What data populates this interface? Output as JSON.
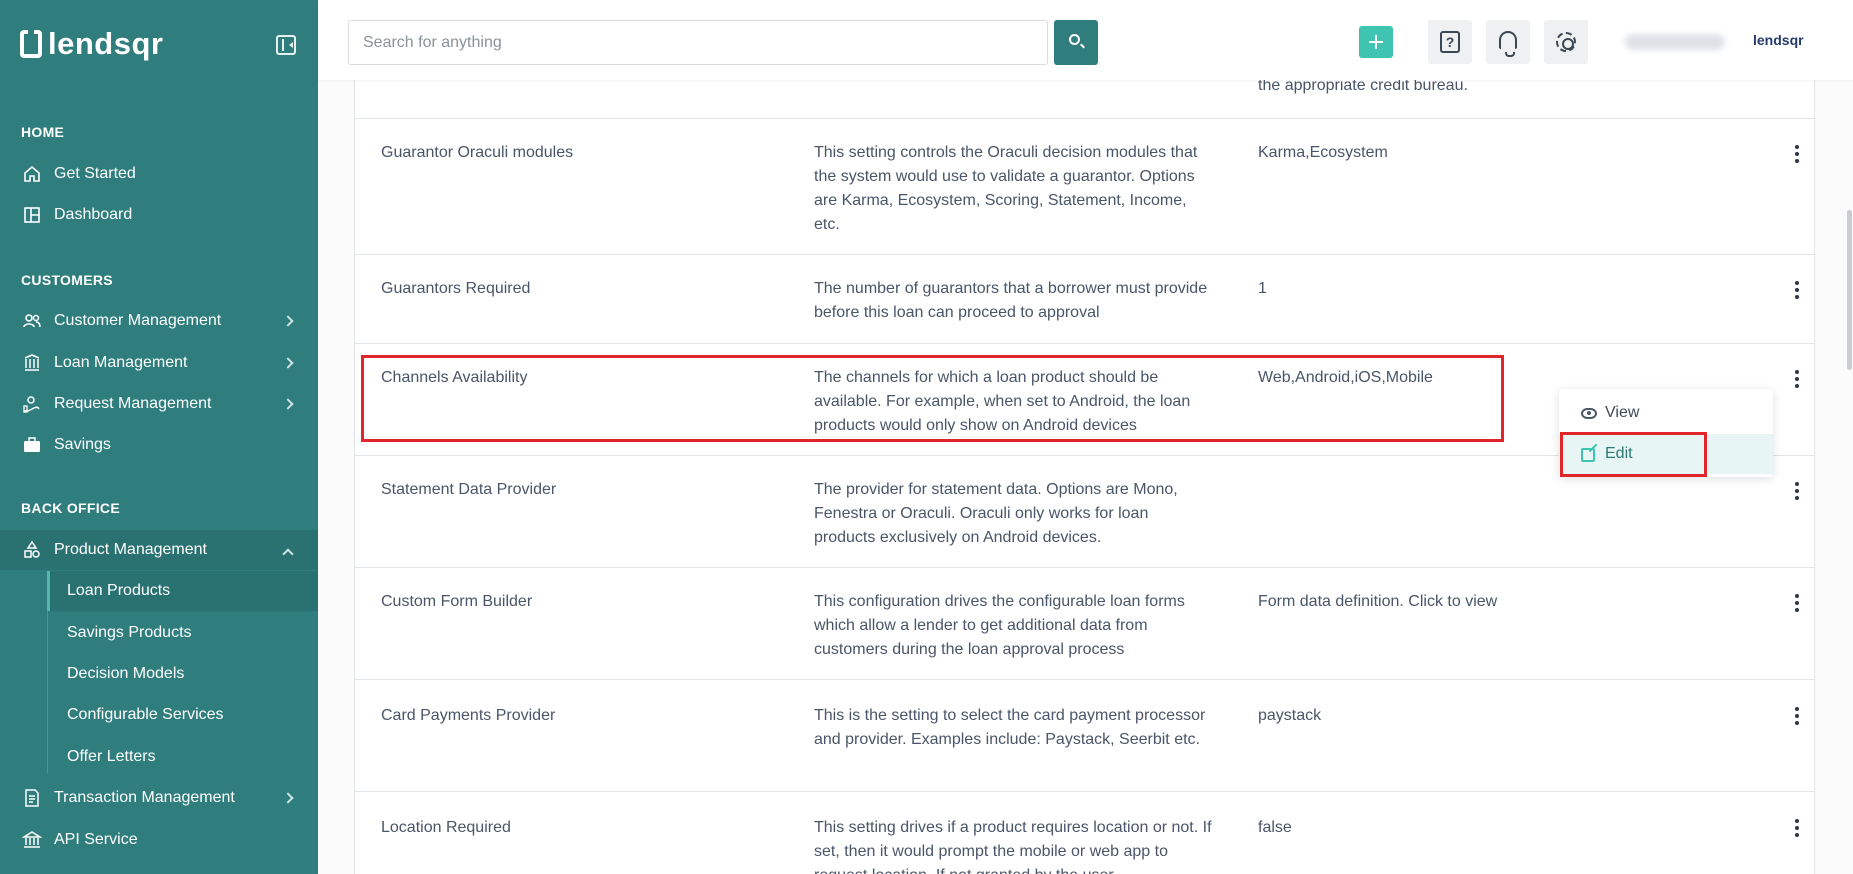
{
  "brand": {
    "name": "lendsqr"
  },
  "sidebar": {
    "sections": {
      "home": "HOME",
      "customers": "CUSTOMERS",
      "back_office": "BACK OFFICE"
    },
    "items": {
      "get_started": "Get Started",
      "dashboard": "Dashboard",
      "customer_management": "Customer Management",
      "loan_management": "Loan Management",
      "request_management": "Request Management",
      "savings": "Savings",
      "product_management": "Product Management",
      "transaction_management": "Transaction Management",
      "api_service": "API Service"
    },
    "sub_items": {
      "loan_products": "Loan Products",
      "savings_products": "Savings Products",
      "decision_models": "Decision Models",
      "configurable_services": "Configurable Services",
      "offer_letters": "Offer Letters"
    }
  },
  "topbar": {
    "search_placeholder": "Search for anything",
    "logo_text": "lendsqr"
  },
  "table": {
    "partial_top_value": "the appropriate credit bureau.",
    "rows": [
      {
        "name": "Guarantor Oraculi modules",
        "description": "This setting controls the Oraculi decision modules that the system would use to validate a guarantor. Options are Karma, Ecosystem, Scoring, Statement, Income, etc.",
        "value": "Karma,Ecosystem"
      },
      {
        "name": "Guarantors Required",
        "description": "The number of guarantors that a borrower must provide before this loan can proceed to approval",
        "value": "1"
      },
      {
        "name": "Channels Availability",
        "description": "The channels for which a loan product should be available. For example, when set to Android, the loan products would only show on Android devices",
        "value": "Web,Android,iOS,Mobile"
      },
      {
        "name": "Statement Data Provider",
        "description": "The provider for statement data. Options are Mono, Fenestra or Oraculi. Oraculi only works for loan products exclusively on Android devices.",
        "value": ""
      },
      {
        "name": "Custom Form Builder",
        "description": "This configuration drives the configurable loan forms which allow a lender to get additional data from customers during the loan approval process",
        "value": "Form data definition. Click to view"
      },
      {
        "name": "Card Payments Provider",
        "description": "This is the setting to select the card payment processor and provider. Examples include: Paystack, Seerbit etc.",
        "value": "paystack"
      },
      {
        "name": "Location Required",
        "description": "This setting drives if a product requires location or not. If set, then it would prompt the mobile or web app to request location. If not granted by the user",
        "value": "false"
      }
    ]
  },
  "action_menu": {
    "view": "View",
    "edit": "Edit"
  },
  "colors": {
    "sidebar_bg": "#2f7d7d",
    "accent_teal": "#3ec4b1",
    "highlight_red": "#e0252b"
  }
}
